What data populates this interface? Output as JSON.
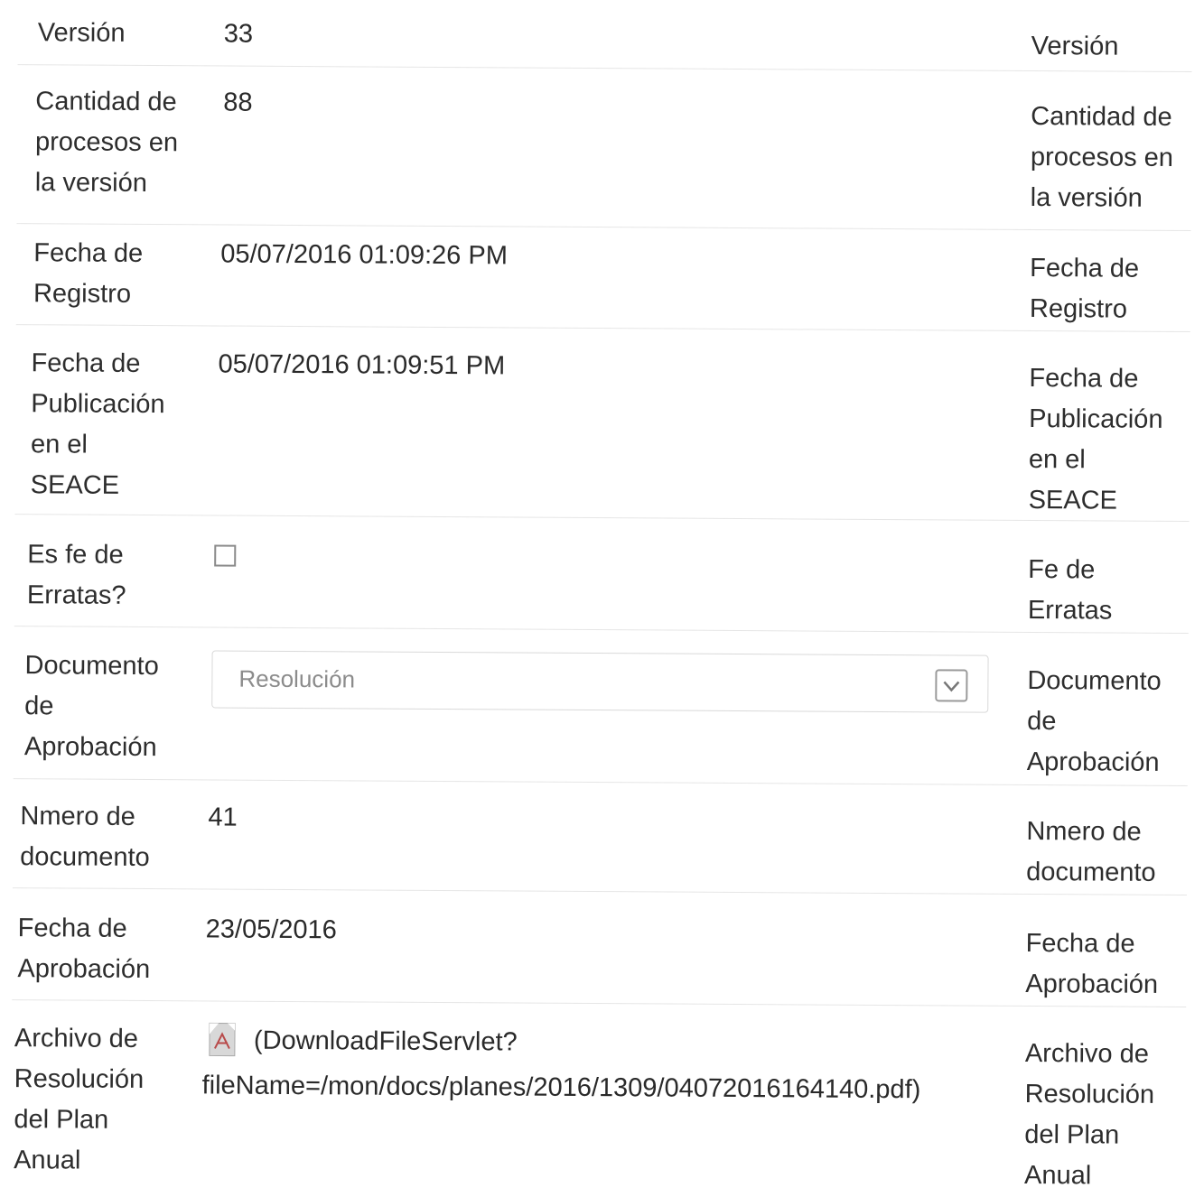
{
  "rows": {
    "version": {
      "label": [
        "Versión"
      ],
      "value": "33",
      "right_label": [
        "Versión"
      ]
    },
    "cantidad": {
      "label": [
        "Cantidad de",
        "procesos en",
        "la versión"
      ],
      "value": "88",
      "right_label": [
        "Cantidad de",
        "procesos en",
        "la versión"
      ]
    },
    "fecha_registro": {
      "label": [
        "Fecha de",
        "Registro"
      ],
      "value": "05/07/2016 01:09:26 PM",
      "right_label": [
        "Fecha de",
        "Registro"
      ]
    },
    "fecha_publicacion": {
      "label": [
        "Fecha de",
        "Publicación",
        "en el",
        "SEACE"
      ],
      "value": "05/07/2016 01:09:51 PM",
      "right_label": [
        "Fecha de",
        "Publicación",
        "en el",
        "SEACE"
      ]
    },
    "fe_erratas": {
      "label": [
        "Es fe de",
        "Erratas?"
      ],
      "checked": false,
      "right_label": [
        "Fe de",
        "Erratas"
      ]
    },
    "documento_aprobacion": {
      "label": [
        "Documento",
        "de",
        "Aprobación"
      ],
      "select_value": "Resolución",
      "right_label": [
        "Documento",
        "de",
        "Aprobación"
      ]
    },
    "numero_documento": {
      "label": [
        "Nmero de",
        "documento"
      ],
      "value": "41",
      "right_label": [
        "Nmero de",
        "documento"
      ]
    },
    "fecha_aprobacion": {
      "label": [
        "Fecha de",
        "Aprobación"
      ],
      "value": "23/05/2016",
      "right_label": [
        "Fecha de",
        "Aprobación"
      ]
    },
    "archivo_resolucion": {
      "label": [
        "Archivo de",
        "Resolución",
        "del Plan",
        "Anual"
      ],
      "file_link": [
        "(DownloadFileServlet?",
        "fileName=/mon/docs/planes/2016/1309/04072016164140.pdf)"
      ],
      "icon": "pdf-file-icon",
      "right_label": [
        "Archivo de",
        "Resolución",
        "del Plan",
        "Anual"
      ]
    }
  }
}
